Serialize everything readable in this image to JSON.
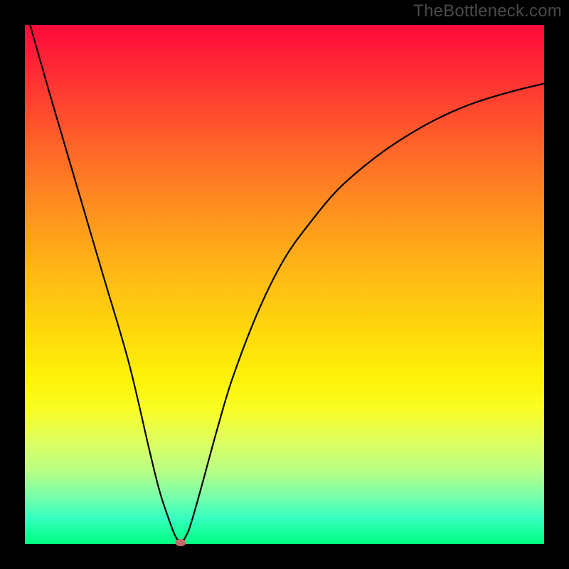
{
  "watermark": "TheBottleneck.com",
  "colors": {
    "page_bg": "#000000",
    "curve": "#000000",
    "marker": "#c56b6b",
    "gradient_top": "#ff0a3a",
    "gradient_bottom": "#00ff80"
  },
  "chart_data": {
    "type": "line",
    "title": "",
    "xlabel": "",
    "ylabel": "",
    "xlim": [
      0,
      100
    ],
    "ylim": [
      0,
      100
    ],
    "grid": false,
    "legend": false,
    "annotations": [],
    "series": [
      {
        "name": "curve",
        "x": [
          1,
          5,
          10,
          15,
          20,
          24,
          26,
          28,
          29,
          30,
          31,
          32,
          34,
          37,
          40,
          45,
          50,
          55,
          60,
          65,
          70,
          75,
          80,
          85,
          90,
          95,
          100
        ],
        "y": [
          100,
          86,
          69,
          52,
          35,
          18,
          10,
          4,
          1.5,
          0.3,
          1.5,
          4,
          11,
          22,
          32,
          45,
          55,
          62,
          68,
          72.5,
          76.3,
          79.5,
          82.2,
          84.4,
          86.1,
          87.5,
          88.7
        ]
      }
    ],
    "marker": {
      "x": 30,
      "y": 0.3
    }
  }
}
